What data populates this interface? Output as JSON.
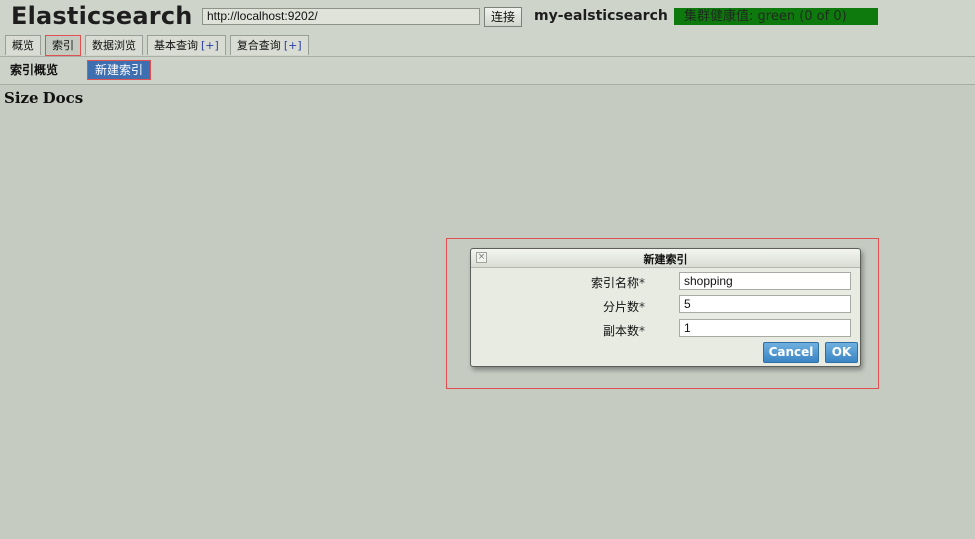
{
  "header": {
    "app_title": "Elasticsearch",
    "url": "http://localhost:9202/",
    "connect_label": "连接",
    "cluster_name": "my-ealsticsearch",
    "health": "集群健康值: green (0 of 0)"
  },
  "tabs": [
    {
      "label": "概览",
      "plus": ""
    },
    {
      "label": "索引",
      "plus": ""
    },
    {
      "label": "数据浏览",
      "plus": ""
    },
    {
      "label": "基本查询",
      "plus": "[+]"
    },
    {
      "label": "复合查询",
      "plus": "[+]"
    }
  ],
  "toolbar": {
    "overview": "索引概览",
    "new_index": "新建索引"
  },
  "columns": {
    "size": "Size",
    "docs": "Docs"
  },
  "dialog": {
    "fields": [
      {
        "label": "索引名称",
        "required": "*",
        "value": "shopping"
      },
      {
        "label": "分片数",
        "required": "*",
        "value": "5"
      },
      {
        "label": "副本数",
        "required": "*",
        "value": "1"
      }
    ],
    "cancel": "Cancel",
    "ok": "OK"
  },
  "colors": {
    "background": "#c5cbc1",
    "health_green": "#0e7a0e",
    "primary_button": "#3e6fb1",
    "dialog_button": "#3a85c4",
    "highlight": "#e05050"
  }
}
